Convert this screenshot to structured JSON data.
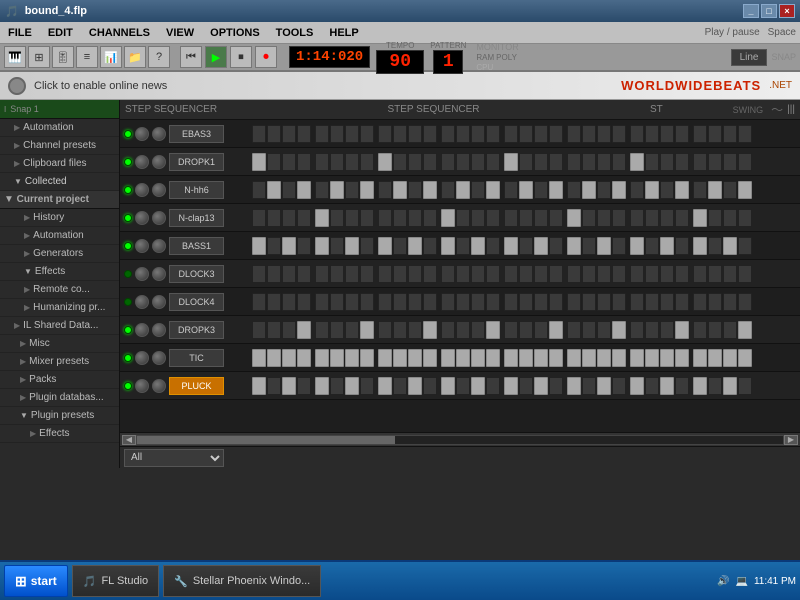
{
  "titlebar": {
    "title": "bound_4.flp",
    "controls": [
      "_",
      "□",
      "×"
    ]
  },
  "menubar": {
    "items": [
      "FILE",
      "EDIT",
      "CHANNELS",
      "VIEW",
      "OPTIONS",
      "TOOLS",
      "HELP"
    ]
  },
  "toolbar": {
    "play_pause": "Play / pause",
    "shortcut": "Space"
  },
  "news_bar": {
    "text": "Click to enable online news",
    "brand": "WORLDWIDEBEATS"
  },
  "transport": {
    "bpm_display": "1:14:020",
    "tempo_label": "TEMPO",
    "pattern_label": "PATTERN",
    "tempo_value": "90",
    "pattern_value": "1",
    "monitor_label": "MONITOR",
    "snap_label": "SNAP",
    "line_label": "Line"
  },
  "sidebar": {
    "items": [
      {
        "label": "Automation",
        "indent": 2
      },
      {
        "label": "Channel presets",
        "indent": 2
      },
      {
        "label": "Clipboard files",
        "indent": 2
      },
      {
        "label": "Collected",
        "indent": 2
      },
      {
        "label": "Current project",
        "indent": 1
      },
      {
        "label": "History",
        "indent": 3
      },
      {
        "label": "Automation",
        "indent": 3
      },
      {
        "label": "Generators",
        "indent": 3
      },
      {
        "label": "Effects",
        "indent": 3
      },
      {
        "label": "Remote co...",
        "indent": 3
      },
      {
        "label": "Humanizing pr...",
        "indent": 3
      },
      {
        "label": "IL Shared Data...",
        "indent": 1
      },
      {
        "label": "Misc",
        "indent": 2
      },
      {
        "label": "Mixer presets",
        "indent": 2
      },
      {
        "label": "Packs",
        "indent": 2
      },
      {
        "label": "Plugin databas...",
        "indent": 2
      },
      {
        "label": "Plugin presets",
        "indent": 2
      },
      {
        "label": "Effects",
        "indent": 3
      }
    ]
  },
  "sequencer": {
    "header_labels": [
      "STEP SEQUENCER",
      "STEP SEQUENCER",
      "ST"
    ],
    "filter": "All",
    "instruments": [
      {
        "name": "EBAS3",
        "highlighted": false,
        "pads": [
          0,
          0,
          0,
          0,
          0,
          0,
          0,
          0,
          0,
          0,
          0,
          0,
          0,
          0,
          0,
          0,
          0,
          0,
          0,
          0,
          0,
          0,
          0,
          0,
          0,
          0,
          0,
          0,
          0,
          0,
          0,
          0
        ]
      },
      {
        "name": "DROPK1",
        "highlighted": false,
        "pads": [
          1,
          0,
          0,
          0,
          0,
          0,
          0,
          0,
          1,
          0,
          0,
          0,
          0,
          0,
          0,
          0,
          1,
          0,
          0,
          0,
          0,
          0,
          0,
          0,
          1,
          0,
          0,
          0,
          0,
          0,
          0,
          0
        ]
      },
      {
        "name": "N-hh6",
        "highlighted": false,
        "pads": [
          0,
          0,
          1,
          0,
          0,
          0,
          1,
          0,
          0,
          0,
          1,
          0,
          0,
          0,
          1,
          0,
          0,
          0,
          1,
          0,
          0,
          0,
          1,
          0,
          0,
          0,
          1,
          0,
          0,
          0,
          1,
          0
        ]
      },
      {
        "name": "N-clap13",
        "highlighted": false,
        "pads": [
          0,
          0,
          0,
          0,
          1,
          0,
          0,
          0,
          0,
          0,
          0,
          0,
          1,
          0,
          0,
          0,
          0,
          0,
          0,
          0,
          1,
          0,
          0,
          0,
          0,
          0,
          0,
          0,
          1,
          0,
          0,
          0
        ]
      },
      {
        "name": "BASS1",
        "highlighted": false,
        "pads": [
          1,
          0,
          0,
          1,
          0,
          0,
          1,
          0,
          0,
          1,
          0,
          0,
          1,
          0,
          0,
          1,
          0,
          0,
          1,
          0,
          0,
          1,
          0,
          0,
          1,
          0,
          0,
          1,
          0,
          0,
          1,
          0
        ]
      },
      {
        "name": "DLOCK3",
        "highlighted": false,
        "pads": [
          0,
          0,
          0,
          0,
          0,
          0,
          0,
          0,
          0,
          0,
          0,
          0,
          0,
          0,
          0,
          0,
          0,
          0,
          0,
          0,
          0,
          0,
          0,
          0,
          0,
          0,
          0,
          0,
          0,
          0,
          0,
          0
        ]
      },
      {
        "name": "DLOCK4",
        "highlighted": false,
        "pads": [
          0,
          0,
          0,
          0,
          0,
          0,
          0,
          0,
          0,
          0,
          0,
          0,
          0,
          0,
          0,
          0,
          0,
          0,
          0,
          0,
          0,
          0,
          0,
          0,
          0,
          0,
          0,
          0,
          0,
          0,
          0,
          0
        ]
      },
      {
        "name": "DROPK3",
        "highlighted": false,
        "pads": [
          0,
          0,
          0,
          0,
          0,
          0,
          0,
          1,
          0,
          0,
          0,
          0,
          0,
          0,
          0,
          1,
          0,
          0,
          0,
          0,
          0,
          0,
          0,
          1,
          0,
          0,
          0,
          0,
          0,
          0,
          0,
          1
        ]
      },
      {
        "name": "TIC",
        "highlighted": false,
        "pads": [
          1,
          1,
          1,
          1,
          1,
          1,
          1,
          1,
          1,
          1,
          1,
          1,
          1,
          1,
          1,
          1,
          1,
          1,
          1,
          1,
          1,
          1,
          1,
          1,
          1,
          1,
          1,
          1,
          1,
          1,
          1,
          1
        ]
      },
      {
        "name": "PLUCK",
        "highlighted": true,
        "pads": [
          1,
          0,
          1,
          0,
          1,
          0,
          1,
          0,
          1,
          0,
          1,
          0,
          1,
          0,
          1,
          0,
          1,
          0,
          1,
          0,
          1,
          0,
          1,
          0,
          1,
          0,
          1,
          0,
          1,
          0,
          1,
          0
        ]
      }
    ]
  },
  "taskbar": {
    "start_label": "start",
    "apps": [
      {
        "label": "FL Studio",
        "icon": "🎵"
      },
      {
        "label": "Stellar Phoenix Windo...",
        "icon": "🔧"
      }
    ],
    "time": "11:41 PM",
    "tray_icons": [
      "🔊",
      "💻"
    ]
  }
}
